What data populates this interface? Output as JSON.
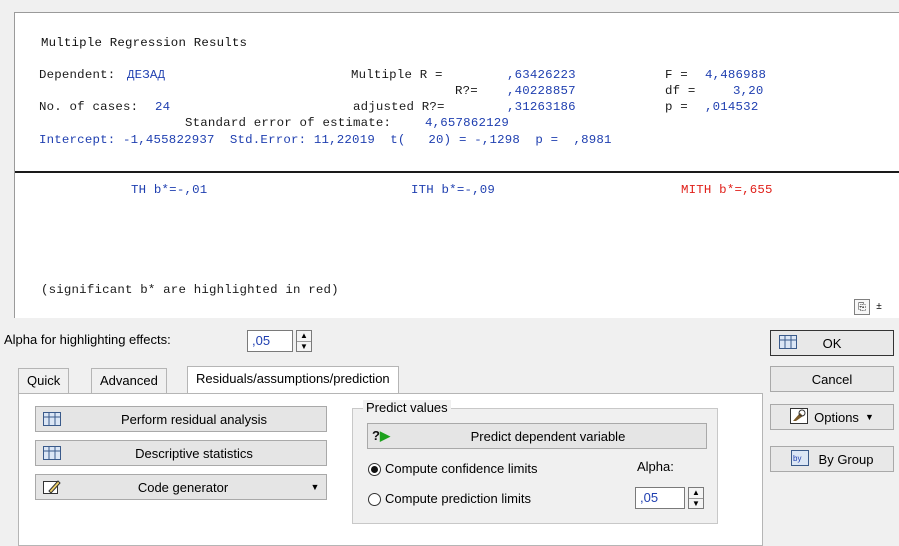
{
  "results": {
    "title": "Multiple Regression Results",
    "dependent_label": "Dependent:",
    "dependent_value": "ДЕЗАД",
    "multiple_r_label": "Multiple R =",
    "multiple_r_value": ",63426223",
    "f_label": "F =",
    "f_value": "4,486988",
    "r2_label": "R?=",
    "r2_value": ",40228857",
    "df_label": "df =",
    "df_value": "3,20",
    "cases_label": "No. of cases:",
    "cases_value": "24",
    "adj_r2_label": "adjusted R?=",
    "adj_r2_value": ",31263186",
    "p_label": "p =",
    "p_value": ",014532",
    "se_label": "Standard error of estimate:",
    "se_value": "4,657862129",
    "intercept_line": "Intercept: -1,455822937  Std.Error: 11,22019  t(   20) = -,1298  p =  ,8981",
    "coef1": "TH b*=-,01",
    "coef2": "ITH b*=-,09",
    "coef3": "MITH b*=,655",
    "note": "(significant b* are highlighted in red)"
  },
  "alpha_effects": {
    "label": "Alpha for highlighting effects:",
    "value": ",05"
  },
  "tabs": [
    {
      "label": "Quick"
    },
    {
      "label": "Advanced"
    },
    {
      "label": "Residuals/assumptions/prediction"
    }
  ],
  "left_buttons": {
    "residual": "Perform residual analysis",
    "descriptive": "Descriptive statistics",
    "codegen": "Code generator"
  },
  "predict": {
    "group_title": "Predict values",
    "button": "Predict dependent variable",
    "confidence": "Compute confidence limits",
    "prediction": "Compute prediction limits",
    "alpha_label": "Alpha:",
    "alpha_value": ",05",
    "selected": "confidence"
  },
  "right_buttons": {
    "ok": "OK",
    "cancel": "Cancel",
    "options": "Options",
    "bygroup": "By Group"
  },
  "colors": {
    "highlight": "#e0201a",
    "value_blue": "#1f3fb0"
  }
}
